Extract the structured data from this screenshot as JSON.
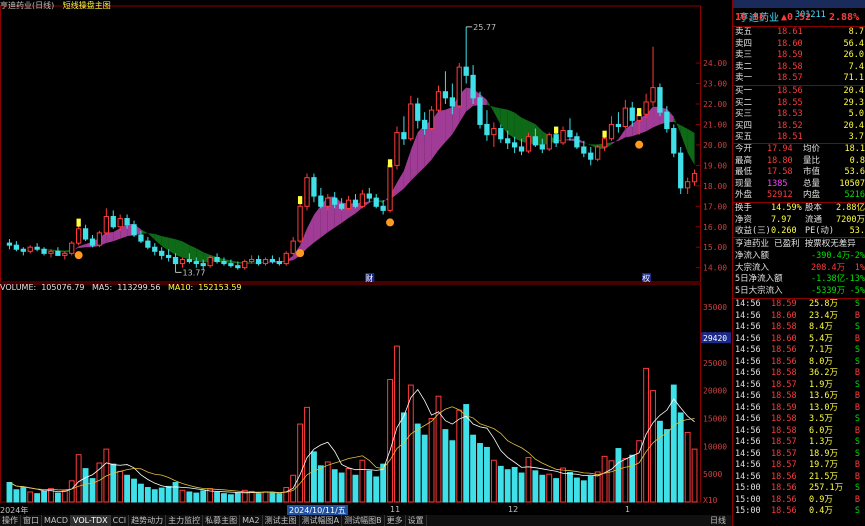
{
  "header": {
    "title": "亨迪药业(日线)",
    "indicator": "短线操盘主图"
  },
  "chart": {
    "high_label": "25.77",
    "low_label": "13.77",
    "price_ticks": [
      "24.00",
      "23.00",
      "22.00",
      "21.00",
      "20.00",
      "19.00",
      "18.00",
      "17.00",
      "16.00",
      "15.00",
      "14.00"
    ],
    "vol_ticks": [
      "35000",
      "30000",
      "25000",
      "20000",
      "15000",
      "10000",
      "5000",
      "X10"
    ],
    "vol_marker": "29420",
    "event_marks": [
      "财",
      "权"
    ],
    "candles": [
      [
        15.2,
        15.4,
        14.9,
        15.1
      ],
      [
        15.1,
        15.3,
        14.8,
        14.9
      ],
      [
        14.9,
        15.0,
        14.6,
        14.8
      ],
      [
        14.8,
        15.1,
        14.7,
        15.0
      ],
      [
        15.0,
        15.2,
        14.8,
        14.9
      ],
      [
        14.9,
        15.0,
        14.6,
        14.7
      ],
      [
        14.7,
        14.9,
        14.5,
        14.8
      ],
      [
        14.8,
        15.0,
        14.6,
        14.6
      ],
      [
        14.6,
        14.8,
        14.4,
        14.7
      ],
      [
        14.7,
        15.3,
        14.6,
        15.2
      ],
      [
        15.2,
        16.3,
        15.1,
        15.9
      ],
      [
        15.9,
        16.1,
        15.3,
        15.4
      ],
      [
        15.4,
        15.6,
        15.0,
        15.1
      ],
      [
        15.1,
        15.8,
        15.0,
        15.7
      ],
      [
        15.7,
        16.9,
        15.6,
        16.5
      ],
      [
        16.5,
        16.8,
        15.9,
        16.0
      ],
      [
        16.0,
        16.6,
        15.8,
        16.4
      ],
      [
        16.4,
        16.6,
        15.9,
        16.1
      ],
      [
        16.1,
        16.3,
        15.5,
        15.6
      ],
      [
        15.6,
        15.8,
        15.2,
        15.3
      ],
      [
        15.3,
        15.5,
        14.9,
        15.0
      ],
      [
        15.0,
        15.2,
        14.6,
        14.8
      ],
      [
        14.8,
        15.0,
        14.4,
        14.6
      ],
      [
        14.6,
        14.9,
        14.3,
        14.5
      ],
      [
        14.5,
        14.7,
        13.77,
        14.2
      ],
      [
        14.2,
        14.5,
        14.0,
        14.4
      ],
      [
        14.4,
        14.7,
        14.2,
        14.3
      ],
      [
        14.3,
        14.5,
        14.0,
        14.2
      ],
      [
        14.2,
        14.4,
        13.9,
        14.1
      ],
      [
        14.1,
        14.6,
        14.0,
        14.5
      ],
      [
        14.5,
        14.7,
        14.2,
        14.3
      ],
      [
        14.3,
        14.5,
        14.1,
        14.2
      ],
      [
        14.2,
        14.4,
        14.0,
        14.1
      ],
      [
        14.1,
        14.3,
        13.9,
        14.0
      ],
      [
        14.0,
        14.4,
        13.9,
        14.3
      ],
      [
        14.3,
        14.6,
        14.2,
        14.4
      ],
      [
        14.4,
        14.6,
        14.1,
        14.2
      ],
      [
        14.2,
        14.5,
        14.1,
        14.4
      ],
      [
        14.4,
        14.6,
        14.2,
        14.3
      ],
      [
        14.3,
        14.5,
        14.1,
        14.2
      ],
      [
        14.2,
        14.8,
        14.1,
        14.7
      ],
      [
        14.7,
        15.5,
        14.6,
        15.3
      ],
      [
        15.3,
        17.4,
        15.2,
        17.0
      ],
      [
        17.0,
        18.6,
        16.8,
        18.4
      ],
      [
        18.4,
        18.6,
        17.2,
        17.5
      ],
      [
        17.5,
        17.9,
        16.9,
        17.0
      ],
      [
        17.0,
        17.6,
        16.8,
        17.4
      ],
      [
        17.4,
        17.7,
        16.9,
        17.1
      ],
      [
        17.1,
        17.4,
        16.8,
        16.9
      ],
      [
        16.9,
        17.5,
        16.8,
        17.3
      ],
      [
        17.3,
        17.6,
        16.9,
        17.0
      ],
      [
        17.0,
        17.8,
        16.9,
        17.6
      ],
      [
        17.6,
        17.9,
        17.2,
        17.4
      ],
      [
        17.4,
        17.6,
        16.9,
        17.0
      ],
      [
        17.0,
        17.3,
        16.6,
        16.8
      ],
      [
        16.8,
        19.2,
        16.7,
        19.0
      ],
      [
        19.0,
        20.9,
        18.8,
        20.6
      ],
      [
        20.6,
        21.4,
        20.0,
        20.3
      ],
      [
        20.3,
        22.4,
        20.2,
        22.0
      ],
      [
        22.0,
        22.3,
        20.8,
        21.2
      ],
      [
        21.2,
        21.6,
        20.5,
        20.8
      ],
      [
        20.8,
        21.9,
        20.7,
        21.7
      ],
      [
        21.7,
        22.9,
        21.6,
        22.6
      ],
      [
        22.6,
        23.6,
        22.0,
        22.3
      ],
      [
        22.3,
        23.0,
        21.5,
        21.9
      ],
      [
        21.9,
        24.0,
        21.8,
        23.8
      ],
      [
        23.8,
        25.77,
        23.0,
        23.4
      ],
      [
        23.4,
        23.9,
        22.0,
        22.3
      ],
      [
        22.3,
        22.6,
        20.8,
        21.0
      ],
      [
        21.0,
        21.7,
        20.2,
        20.5
      ],
      [
        20.5,
        21.1,
        19.9,
        20.8
      ],
      [
        20.8,
        21.0,
        20.1,
        20.3
      ],
      [
        20.3,
        20.7,
        19.8,
        20.1
      ],
      [
        20.1,
        20.4,
        19.6,
        19.9
      ],
      [
        19.9,
        20.3,
        19.5,
        19.7
      ],
      [
        19.7,
        20.6,
        19.6,
        20.4
      ],
      [
        20.4,
        20.8,
        19.9,
        20.0
      ],
      [
        20.0,
        20.3,
        19.6,
        19.8
      ],
      [
        19.8,
        20.6,
        19.7,
        20.5
      ],
      [
        20.5,
        20.7,
        19.9,
        20.1
      ],
      [
        20.1,
        20.9,
        20.0,
        20.7
      ],
      [
        20.7,
        21.3,
        20.2,
        20.4
      ],
      [
        20.4,
        20.6,
        19.8,
        19.9
      ],
      [
        19.9,
        20.2,
        19.4,
        19.6
      ],
      [
        19.6,
        19.9,
        19.0,
        19.3
      ],
      [
        19.3,
        20.0,
        19.2,
        19.9
      ],
      [
        19.9,
        20.5,
        19.7,
        20.3
      ],
      [
        20.3,
        21.4,
        20.2,
        21.0
      ],
      [
        21.0,
        21.6,
        20.6,
        20.9
      ],
      [
        20.9,
        22.2,
        20.8,
        21.8
      ],
      [
        21.8,
        22.1,
        20.9,
        21.2
      ],
      [
        21.2,
        21.7,
        20.5,
        21.5
      ],
      [
        21.5,
        22.5,
        21.3,
        22.1
      ],
      [
        22.1,
        24.8,
        21.9,
        22.8
      ],
      [
        22.8,
        23.0,
        21.4,
        21.6
      ],
      [
        21.6,
        21.9,
        20.6,
        20.8
      ],
      [
        20.8,
        21.0,
        19.4,
        19.6
      ],
      [
        19.6,
        19.9,
        17.6,
        17.9
      ],
      [
        17.9,
        18.4,
        17.6,
        18.2
      ],
      [
        18.2,
        18.8,
        18.0,
        18.6
      ]
    ],
    "volumes": [
      3500,
      2200,
      2600,
      1800,
      1500,
      1900,
      2400,
      1600,
      2000,
      3800,
      8500,
      6000,
      4200,
      7000,
      9500,
      6800,
      5500,
      4800,
      4100,
      3200,
      2600,
      2200,
      2500,
      2800,
      3500,
      2100,
      1800,
      1600,
      2000,
      2400,
      1700,
      1500,
      1300,
      1600,
      2100,
      1900,
      1500,
      1800,
      1700,
      1500,
      2600,
      4800,
      14000,
      17000,
      9000,
      6500,
      7200,
      5800,
      5200,
      6000,
      4800,
      7500,
      5600,
      4500,
      6800,
      22000,
      28000,
      16000,
      21000,
      14000,
      12000,
      15000,
      19000,
      13000,
      11000,
      16500,
      17500,
      12000,
      10500,
      9800,
      7500,
      6400,
      5800,
      6200,
      5200,
      8000,
      5600,
      4800,
      5000,
      4200,
      6100,
      5300,
      4300,
      3800,
      4600,
      5400,
      8200,
      7400,
      9600,
      7800,
      8400,
      11000,
      24000,
      20000,
      14500,
      13000,
      21000,
      16000,
      12500,
      9500
    ]
  },
  "vol_legend": {
    "label": "VOLUME:",
    "volume": "105076.79",
    "ma5_label": "MA5:",
    "ma5": "113299.56",
    "ma10_label": "MA10:",
    "ma10": "152153.59"
  },
  "timebar": {
    "left": "2024年",
    "date": "2024/10/11/五",
    "m11": "11",
    "m12": "12",
    "m1": "1"
  },
  "bottom_tabs": [
    "操作",
    "窗口",
    "MACD",
    "VOL-TDX",
    "CCI",
    "趋势动力",
    "主力监控",
    "私募主图",
    "MA2",
    "测试主图",
    "测试幅图A",
    "测试幅图B",
    "更多",
    "设置"
  ],
  "bottom_right": "日线",
  "panel": {
    "stock_name": "亨迪药业",
    "stock_code": "301211",
    "price": "18.56",
    "change": "▲0.52",
    "pct": "2.88%",
    "asks": [
      {
        "label": "卖五",
        "price": "18.61",
        "vol": "8.7"
      },
      {
        "label": "卖四",
        "price": "18.60",
        "vol": "56.4"
      },
      {
        "label": "卖三",
        "price": "18.59",
        "vol": "26.0"
      },
      {
        "label": "卖二",
        "price": "18.58",
        "vol": "7.4"
      },
      {
        "label": "卖一",
        "price": "18.57",
        "vol": "71.1"
      }
    ],
    "bids": [
      {
        "label": "买一",
        "price": "18.56",
        "vol": "20.4"
      },
      {
        "label": "买二",
        "price": "18.55",
        "vol": "29.3"
      },
      {
        "label": "买三",
        "price": "18.53",
        "vol": "5.0"
      },
      {
        "label": "买四",
        "price": "18.52",
        "vol": "20.4"
      },
      {
        "label": "买五",
        "price": "18.51",
        "vol": "3.7"
      }
    ],
    "stats": [
      {
        "k1": "今开",
        "v1": "17.94",
        "k2": "均价",
        "v2": "18.1"
      },
      {
        "k1": "最高",
        "v1": "18.80",
        "k2": "量比",
        "v2": "0.8"
      },
      {
        "k1": "最低",
        "v1": "17.58",
        "k2": "市值",
        "v2": "53.6"
      },
      {
        "k1": "现量",
        "v1": "1385",
        "k2": "总量",
        "v2": "10507"
      },
      {
        "k1": "外盘",
        "v1": "52912",
        "k2": "内盘",
        "v2": "5216"
      }
    ],
    "stats2": [
      {
        "k1": "换手",
        "v1": "14.59%",
        "k2": "股本",
        "v2": "2.88亿"
      },
      {
        "k1": "净资",
        "v1": "7.97",
        "k2": "流通",
        "v2": "7200万"
      },
      {
        "k1": "收益(三)",
        "v1": "0.260",
        "k2": "PE(动)",
        "v2": "53."
      }
    ],
    "tagline": "亨迪药业 已盈利 按票权无差异",
    "flows": [
      {
        "k": "净流入额",
        "v1": "-390.4万",
        "v2": "-2%"
      },
      {
        "k": "大宗流入",
        "v1": "208.4万",
        "v2": "1%"
      },
      {
        "k": "5日净流入额",
        "v1": "-1.38亿",
        "v2": "-13%"
      },
      {
        "k": "5日大宗流入",
        "v1": "-5339万",
        "v2": "-5%"
      }
    ],
    "ticks": [
      {
        "t": "14:56",
        "p": "18.59",
        "v": "25.8万",
        "d": "S"
      },
      {
        "t": "14:56",
        "p": "18.60",
        "v": "23.4万",
        "d": "B"
      },
      {
        "t": "14:56",
        "p": "18.58",
        "v": "8.4万",
        "d": "S"
      },
      {
        "t": "14:56",
        "p": "18.60",
        "v": "5.4万",
        "d": "B"
      },
      {
        "t": "14:56",
        "p": "18.56",
        "v": "7.1万",
        "d": "S"
      },
      {
        "t": "14:56",
        "p": "18.56",
        "v": "8.0万",
        "d": "S"
      },
      {
        "t": "14:56",
        "p": "18.58",
        "v": "36.2万",
        "d": "B"
      },
      {
        "t": "14:56",
        "p": "18.57",
        "v": "1.9万",
        "d": "S"
      },
      {
        "t": "14:56",
        "p": "18.58",
        "v": "13.6万",
        "d": "B"
      },
      {
        "t": "14:56",
        "p": "18.59",
        "v": "13.0万",
        "d": "B"
      },
      {
        "t": "14:56",
        "p": "18.58",
        "v": "3.5万",
        "d": "S"
      },
      {
        "t": "14:56",
        "p": "18.58",
        "v": "6.0万",
        "d": "B"
      },
      {
        "t": "14:56",
        "p": "18.57",
        "v": "1.3万",
        "d": "S"
      },
      {
        "t": "14:56",
        "p": "18.57",
        "v": "18.9万",
        "d": "S"
      },
      {
        "t": "14:56",
        "p": "18.57",
        "v": "19.7万",
        "d": "B"
      },
      {
        "t": "14:56",
        "p": "18.56",
        "v": "21.5万",
        "d": "B"
      },
      {
        "t": "15:00",
        "p": "18.56",
        "v": "257.1万",
        "d": "S"
      },
      {
        "t": "15:00",
        "p": "18.56",
        "v": "0.9万",
        "d": "B"
      },
      {
        "t": "15:00",
        "p": "18.56",
        "v": "0.4万",
        "d": "S"
      }
    ]
  },
  "colors": {
    "up": "#ff3b3b",
    "down": "#40e0e8",
    "band_up": "#a03c96",
    "band_down": "#0f6a18",
    "ma5": "#ffffff",
    "ma10": "#e0c040",
    "signal": "#ffff40"
  }
}
